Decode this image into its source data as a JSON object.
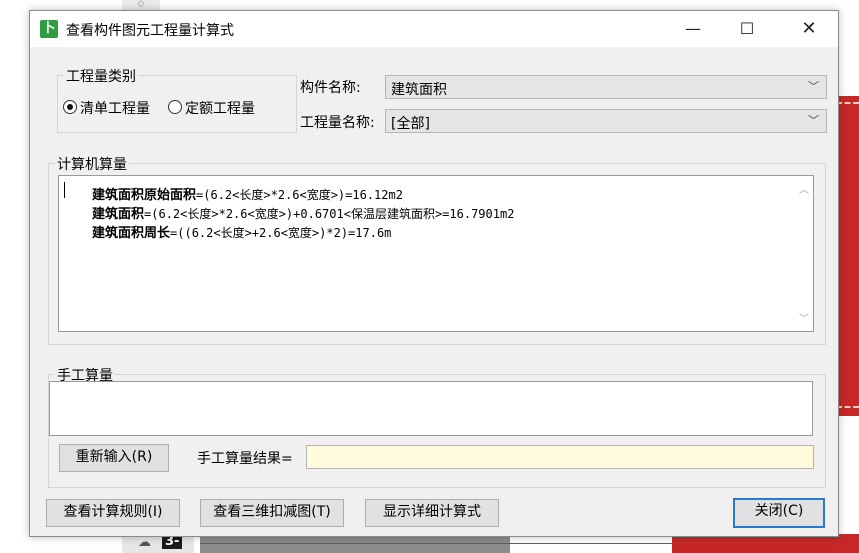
{
  "background": {
    "bottom_label": "3-"
  },
  "window": {
    "title": "查看构件图元工程量计算式",
    "icon_glyph": "卜",
    "minimize": "—",
    "maximize": "☐",
    "close": "✕"
  },
  "quantity_type": {
    "legend": "工程量类别",
    "options": [
      {
        "label": "清单工程量",
        "selected": true
      },
      {
        "label": "定额工程量",
        "selected": false
      }
    ]
  },
  "component": {
    "label": "构件名称:",
    "value": "建筑面积"
  },
  "quantity_name": {
    "label": "工程量名称:",
    "value": "[全部]"
  },
  "computer_calc": {
    "legend": "计算机算量",
    "lines": [
      {
        "name": "建筑面积原始面积",
        "expr": "=(6.2<长度>*2.6<宽度>)=16.12m2"
      },
      {
        "name": "建筑面积",
        "expr": "=(6.2<长度>*2.6<宽度>)+0.6701<保温层建筑面积>=16.7901m2"
      },
      {
        "name": "建筑面积周长",
        "expr": "=((6.2<长度>+2.6<宽度>)*2)=17.6m"
      }
    ]
  },
  "manual_calc": {
    "legend": "手工算量",
    "reenter_button": "重新输入(R)",
    "result_label": "手工算量结果=",
    "result_value": ""
  },
  "footer": {
    "rules_button": "查看计算规则(I)",
    "view3d_button": "查看三维扣减图(T)",
    "detail_button": "显示详细计算式",
    "close_button": "关闭(C)"
  },
  "colors": {
    "accent": "#2b78d4",
    "app_icon": "#2e9d3f",
    "result_bg": "#fffbdc"
  }
}
